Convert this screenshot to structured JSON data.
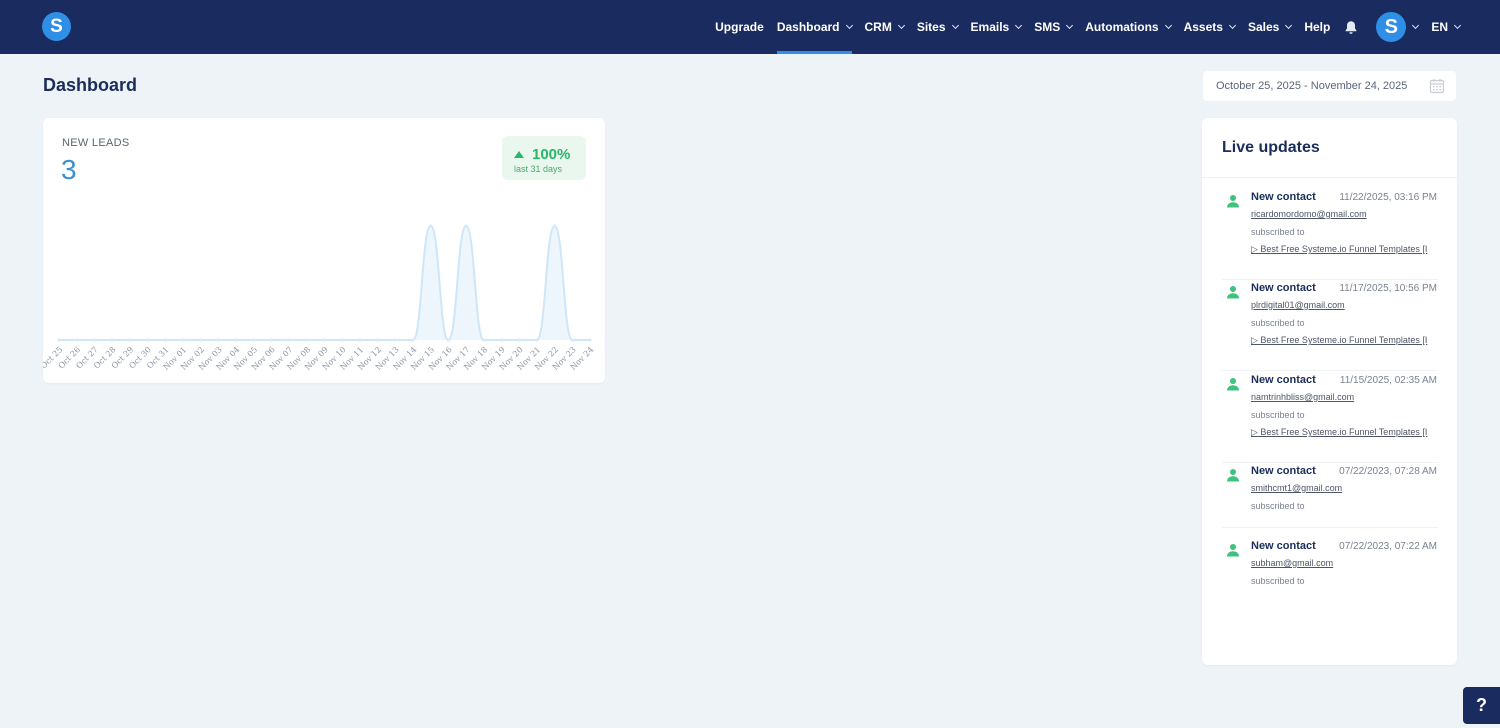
{
  "nav": {
    "items": [
      {
        "label": "Upgrade",
        "dropdown": false,
        "active": false
      },
      {
        "label": "Dashboard",
        "dropdown": true,
        "active": true
      },
      {
        "label": "CRM",
        "dropdown": true,
        "active": false
      },
      {
        "label": "Sites",
        "dropdown": true,
        "active": false
      },
      {
        "label": "Emails",
        "dropdown": true,
        "active": false
      },
      {
        "label": "SMS",
        "dropdown": true,
        "active": false
      },
      {
        "label": "Automations",
        "dropdown": true,
        "active": false
      },
      {
        "label": "Assets",
        "dropdown": true,
        "active": false
      },
      {
        "label": "Sales",
        "dropdown": true,
        "active": false
      },
      {
        "label": "Help",
        "dropdown": false,
        "active": false
      }
    ],
    "logo_letter": "S",
    "avatar_letter": "S",
    "language": "EN",
    "icons": {
      "notification": "bell-icon",
      "calendar": "calendar-icon",
      "contact": "person-icon"
    }
  },
  "page": {
    "title": "Dashboard",
    "date_range": "October 25, 2025 - November 24, 2025"
  },
  "leads": {
    "label": "NEW LEADS",
    "value": "3",
    "change": "100%",
    "change_period": "last 31 days"
  },
  "chart_data": {
    "type": "area",
    "categories": [
      "Oct 25",
      "Oct 26",
      "Oct 27",
      "Oct 28",
      "Oct 29",
      "Oct 30",
      "Oct 31",
      "Nov 01",
      "Nov 02",
      "Nov 03",
      "Nov 04",
      "Nov 05",
      "Nov 06",
      "Nov 07",
      "Nov 08",
      "Nov 09",
      "Nov 10",
      "Nov 11",
      "Nov 12",
      "Nov 13",
      "Nov 14",
      "Nov 15",
      "Nov 16",
      "Nov 17",
      "Nov 18",
      "Nov 19",
      "Nov 20",
      "Nov 21",
      "Nov 22",
      "Nov 23",
      "Nov 24"
    ],
    "values": [
      0,
      0,
      0,
      0,
      0,
      0,
      0,
      0,
      0,
      0,
      0,
      0,
      0,
      0,
      0,
      0,
      0,
      0,
      0,
      0,
      0,
      1,
      0,
      1,
      0,
      0,
      0,
      0,
      1,
      0,
      0
    ],
    "ylim": [
      0,
      1
    ],
    "grid": false,
    "legend": "none",
    "colors": {
      "line": "#cfe6f7",
      "fill": "#eef6fd"
    }
  },
  "live": {
    "title": "Live updates",
    "updates": [
      {
        "type": "New contact",
        "time": "11/22/2025, 03:16 PM",
        "email": "ricardomordomo@gmail.com",
        "action": "subscribed to",
        "funnel": "▷ Best Free Systeme.io Funnel Templates [I"
      },
      {
        "type": "New contact",
        "time": "11/17/2025, 10:56 PM",
        "email": "plrdigital01@gmail.com",
        "action": "subscribed to",
        "funnel": "▷ Best Free Systeme.io Funnel Templates [I"
      },
      {
        "type": "New contact",
        "time": "11/15/2025, 02:35 AM",
        "email": "namtrinhbliss@gmail.com",
        "action": "subscribed to",
        "funnel": "▷ Best Free Systeme.io Funnel Templates [I"
      },
      {
        "type": "New contact",
        "time": "07/22/2023, 07:28 AM",
        "email": "smithcmt1@gmail.com",
        "action": "subscribed to",
        "funnel": ""
      },
      {
        "type": "New contact",
        "time": "07/22/2023, 07:22 AM",
        "email": "subham@gmail.com",
        "action": "subscribed to",
        "funnel": ""
      }
    ]
  },
  "help_button": "?"
}
